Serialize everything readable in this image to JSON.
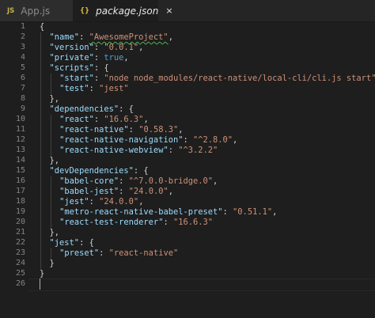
{
  "tabs": [
    {
      "icon": "JS",
      "label": "App.js"
    },
    {
      "icon": "{}",
      "label": "package.json",
      "close": "×"
    }
  ],
  "lines": [
    {
      "n": "1",
      "indent": 0,
      "tokens": [
        {
          "t": "{",
          "c": "p"
        }
      ]
    },
    {
      "n": "2",
      "indent": 1,
      "tokens": [
        {
          "t": "\"name\"",
          "c": "k"
        },
        {
          "t": ": ",
          "c": "p"
        },
        {
          "t": "\"AwesomeProject\"",
          "c": "s",
          "squiggle": true
        },
        {
          "t": ",",
          "c": "p"
        }
      ]
    },
    {
      "n": "3",
      "indent": 1,
      "tokens": [
        {
          "t": "\"version\"",
          "c": "k"
        },
        {
          "t": ": ",
          "c": "p"
        },
        {
          "t": "\"0.0.1\"",
          "c": "s"
        },
        {
          "t": ",",
          "c": "p"
        }
      ]
    },
    {
      "n": "4",
      "indent": 1,
      "tokens": [
        {
          "t": "\"private\"",
          "c": "k"
        },
        {
          "t": ": ",
          "c": "p"
        },
        {
          "t": "true",
          "c": "b"
        },
        {
          "t": ",",
          "c": "p"
        }
      ]
    },
    {
      "n": "5",
      "indent": 1,
      "tokens": [
        {
          "t": "\"scripts\"",
          "c": "k"
        },
        {
          "t": ": {",
          "c": "p"
        }
      ]
    },
    {
      "n": "6",
      "indent": 2,
      "tokens": [
        {
          "t": "\"start\"",
          "c": "k"
        },
        {
          "t": ": ",
          "c": "p"
        },
        {
          "t": "\"node node_modules/react-native/local-cli/cli.js start\"",
          "c": "s"
        },
        {
          "t": ",",
          "c": "p"
        }
      ]
    },
    {
      "n": "7",
      "indent": 2,
      "tokens": [
        {
          "t": "\"test\"",
          "c": "k"
        },
        {
          "t": ": ",
          "c": "p"
        },
        {
          "t": "\"jest\"",
          "c": "s"
        }
      ]
    },
    {
      "n": "8",
      "indent": 1,
      "tokens": [
        {
          "t": "},",
          "c": "p"
        }
      ]
    },
    {
      "n": "9",
      "indent": 1,
      "tokens": [
        {
          "t": "\"dependencies\"",
          "c": "k"
        },
        {
          "t": ": {",
          "c": "p"
        }
      ]
    },
    {
      "n": "10",
      "indent": 2,
      "tokens": [
        {
          "t": "\"react\"",
          "c": "k"
        },
        {
          "t": ": ",
          "c": "p"
        },
        {
          "t": "\"16.6.3\"",
          "c": "s"
        },
        {
          "t": ",",
          "c": "p"
        }
      ]
    },
    {
      "n": "11",
      "indent": 2,
      "tokens": [
        {
          "t": "\"react-native\"",
          "c": "k"
        },
        {
          "t": ": ",
          "c": "p"
        },
        {
          "t": "\"0.58.3\"",
          "c": "s"
        },
        {
          "t": ",",
          "c": "p"
        }
      ]
    },
    {
      "n": "12",
      "indent": 2,
      "tokens": [
        {
          "t": "\"react-native-navigation\"",
          "c": "k"
        },
        {
          "t": ": ",
          "c": "p"
        },
        {
          "t": "\"^2.8.0\"",
          "c": "s"
        },
        {
          "t": ",",
          "c": "p"
        }
      ]
    },
    {
      "n": "13",
      "indent": 2,
      "tokens": [
        {
          "t": "\"react-native-webview\"",
          "c": "k"
        },
        {
          "t": ": ",
          "c": "p"
        },
        {
          "t": "\"^3.2.2\"",
          "c": "s"
        }
      ]
    },
    {
      "n": "14",
      "indent": 1,
      "tokens": [
        {
          "t": "},",
          "c": "p"
        }
      ]
    },
    {
      "n": "15",
      "indent": 1,
      "tokens": [
        {
          "t": "\"devDependencies\"",
          "c": "k"
        },
        {
          "t": ": {",
          "c": "p"
        }
      ]
    },
    {
      "n": "16",
      "indent": 2,
      "tokens": [
        {
          "t": "\"babel-core\"",
          "c": "k"
        },
        {
          "t": ": ",
          "c": "p"
        },
        {
          "t": "\"^7.0.0-bridge.0\"",
          "c": "s"
        },
        {
          "t": ",",
          "c": "p"
        }
      ]
    },
    {
      "n": "17",
      "indent": 2,
      "tokens": [
        {
          "t": "\"babel-jest\"",
          "c": "k"
        },
        {
          "t": ": ",
          "c": "p"
        },
        {
          "t": "\"24.0.0\"",
          "c": "s"
        },
        {
          "t": ",",
          "c": "p"
        }
      ]
    },
    {
      "n": "18",
      "indent": 2,
      "tokens": [
        {
          "t": "\"jest\"",
          "c": "k"
        },
        {
          "t": ": ",
          "c": "p"
        },
        {
          "t": "\"24.0.0\"",
          "c": "s"
        },
        {
          "t": ",",
          "c": "p"
        }
      ]
    },
    {
      "n": "19",
      "indent": 2,
      "tokens": [
        {
          "t": "\"metro-react-native-babel-preset\"",
          "c": "k"
        },
        {
          "t": ": ",
          "c": "p"
        },
        {
          "t": "\"0.51.1\"",
          "c": "s"
        },
        {
          "t": ",",
          "c": "p"
        }
      ]
    },
    {
      "n": "20",
      "indent": 2,
      "tokens": [
        {
          "t": "\"react-test-renderer\"",
          "c": "k"
        },
        {
          "t": ": ",
          "c": "p"
        },
        {
          "t": "\"16.6.3\"",
          "c": "s"
        }
      ]
    },
    {
      "n": "21",
      "indent": 1,
      "tokens": [
        {
          "t": "},",
          "c": "p"
        }
      ]
    },
    {
      "n": "22",
      "indent": 1,
      "tokens": [
        {
          "t": "\"jest\"",
          "c": "k"
        },
        {
          "t": ": {",
          "c": "p"
        }
      ]
    },
    {
      "n": "23",
      "indent": 2,
      "tokens": [
        {
          "t": "\"preset\"",
          "c": "k"
        },
        {
          "t": ": ",
          "c": "p"
        },
        {
          "t": "\"react-native\"",
          "c": "s"
        }
      ]
    },
    {
      "n": "24",
      "indent": 1,
      "tokens": [
        {
          "t": "}",
          "c": "p"
        }
      ]
    },
    {
      "n": "25",
      "indent": 0,
      "tokens": [
        {
          "t": "}",
          "c": "p"
        }
      ]
    },
    {
      "n": "26",
      "indent": 0,
      "tokens": [],
      "cursor": true
    }
  ],
  "colors": {
    "key": "#9cdcfe",
    "string": "#ce9178",
    "boolean": "#569cd6",
    "punctuation": "#d4d4d4",
    "line_number": "#858585",
    "background": "#1e1e1e"
  }
}
